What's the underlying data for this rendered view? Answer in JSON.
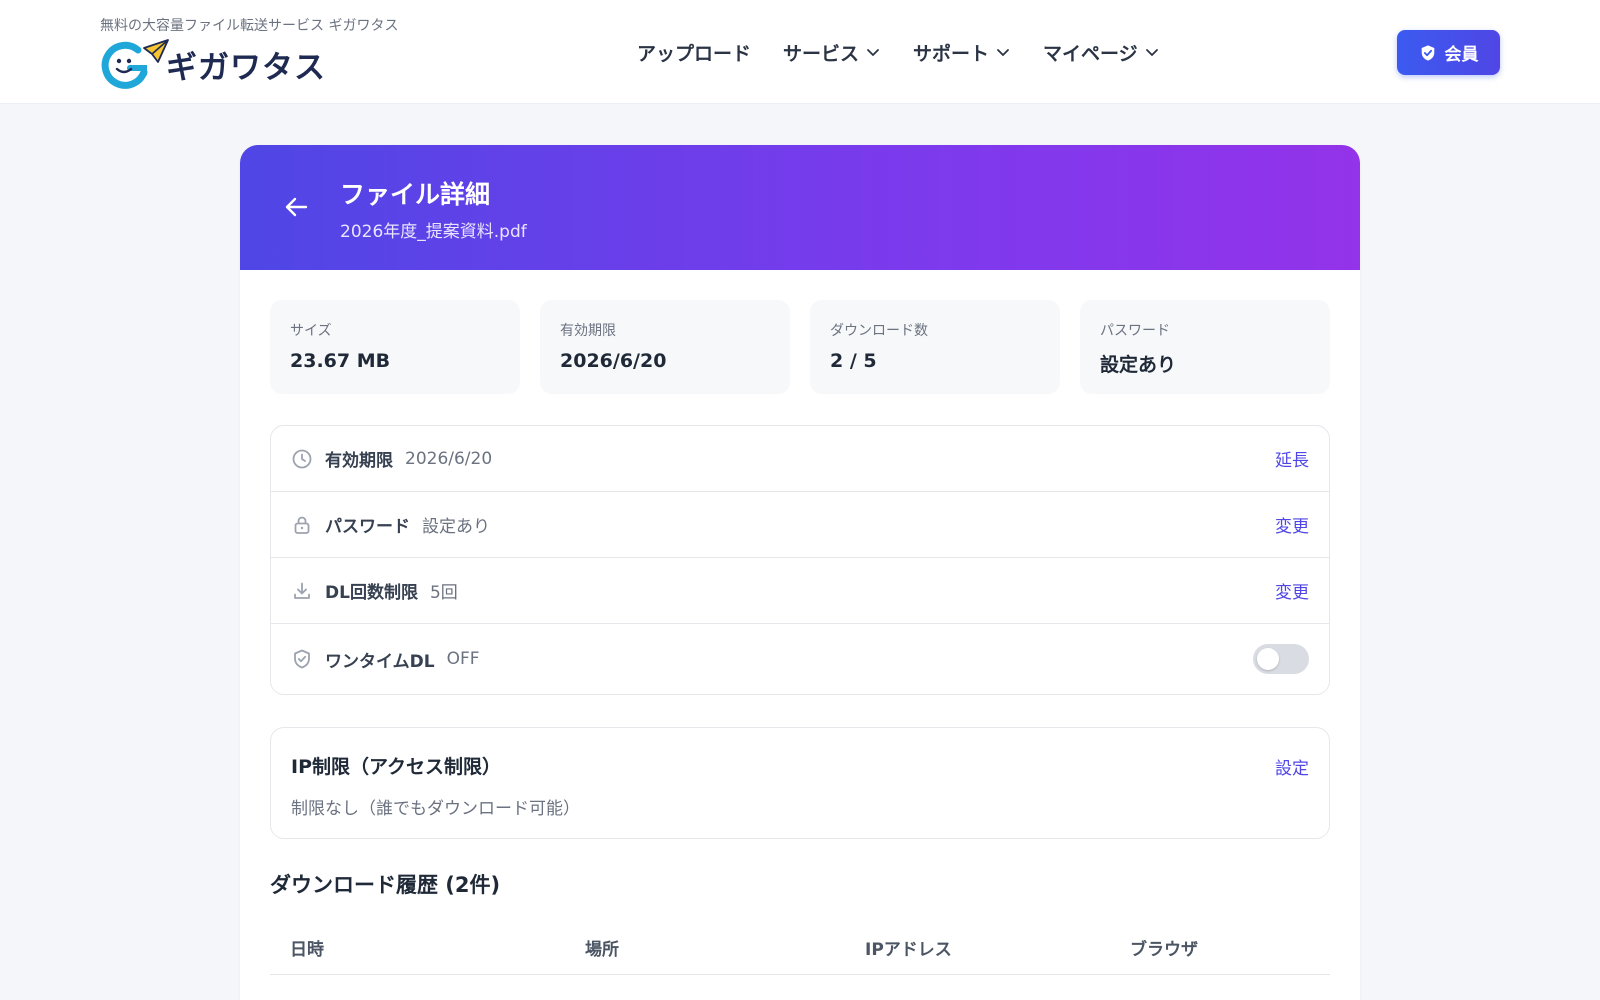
{
  "header": {
    "tagline": "無料の大容量ファイル転送サービス ギガワタス",
    "logo_text": "ギガワタス",
    "nav": [
      {
        "label": "アップロード",
        "has_dropdown": false
      },
      {
        "label": "サービス",
        "has_dropdown": true
      },
      {
        "label": "サポート",
        "has_dropdown": true
      },
      {
        "label": "マイページ",
        "has_dropdown": true
      }
    ],
    "member_button": "会員"
  },
  "hero": {
    "title": "ファイル詳細",
    "filename": "2026年度_提案資料.pdf"
  },
  "stats": [
    {
      "label": "サイズ",
      "value": "23.67 MB"
    },
    {
      "label": "有効期限",
      "value": "2026/6/20"
    },
    {
      "label": "ダウンロード数",
      "value": "2 / 5"
    },
    {
      "label": "パスワード",
      "value": "設定あり"
    }
  ],
  "settings": [
    {
      "icon": "clock-icon",
      "label": "有効期限",
      "value": "2026/6/20",
      "action": "延長"
    },
    {
      "icon": "lock-icon",
      "label": "パスワード",
      "value": "設定あり",
      "action": "変更"
    },
    {
      "icon": "download-icon",
      "label": "DL回数制限",
      "value": "5回",
      "action": "変更"
    },
    {
      "icon": "shield-check-icon",
      "label": "ワンタイムDL",
      "value": "OFF",
      "toggle_on": false
    }
  ],
  "ip_restriction": {
    "title": "IP制限（アクセス制限）",
    "description": "制限なし（誰でもダウンロード可能）",
    "action": "設定"
  },
  "history": {
    "title": "ダウンロード履歴 (2件)",
    "columns": [
      "日時",
      "場所",
      "IPアドレス",
      "ブラウザ"
    ]
  },
  "colors": {
    "accent": "#4f46e5",
    "hero_gradient_start": "#4f46e5",
    "hero_gradient_end": "#9333ea",
    "logo_dark": "#1e2a52"
  }
}
